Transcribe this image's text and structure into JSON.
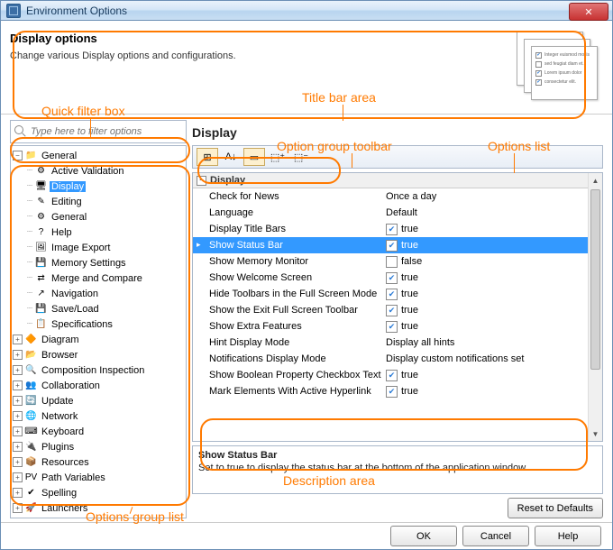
{
  "window": {
    "title": "Environment Options"
  },
  "header": {
    "title": "Display options",
    "subtitle": "Change various Display options and configurations."
  },
  "filter": {
    "placeholder": "Type here to filter options"
  },
  "section_title": "Display",
  "tree": {
    "top": {
      "label": "General",
      "children": [
        "Active Validation",
        "Display",
        "Editing",
        "General",
        "Help",
        "Image Export",
        "Memory Settings",
        "Merge and Compare",
        "Navigation",
        "Save/Load",
        "Specifications"
      ],
      "selected_index": 1
    },
    "rest": [
      "Diagram",
      "Browser",
      "Composition Inspection",
      "Collaboration",
      "Update",
      "Network",
      "Keyboard",
      "Plugins",
      "Resources",
      "Path Variables",
      "Spelling",
      "Launchers"
    ]
  },
  "proplist": {
    "group": "Display",
    "rows": [
      {
        "name": "Check for News",
        "type": "text",
        "value": "Once a day"
      },
      {
        "name": "Language",
        "type": "text",
        "value": "Default"
      },
      {
        "name": "Display Title Bars",
        "type": "check",
        "checked": true,
        "value": "true"
      },
      {
        "name": "Show Status Bar",
        "type": "check",
        "checked": true,
        "value": "true",
        "selected": true
      },
      {
        "name": "Show Memory Monitor",
        "type": "check",
        "checked": false,
        "value": "false"
      },
      {
        "name": "Show Welcome Screen",
        "type": "check",
        "checked": true,
        "value": "true"
      },
      {
        "name": "Hide Toolbars in the Full Screen Mode",
        "type": "check",
        "checked": true,
        "value": "true"
      },
      {
        "name": "Show the Exit Full Screen Toolbar",
        "type": "check",
        "checked": true,
        "value": "true"
      },
      {
        "name": "Show Extra Features",
        "type": "check",
        "checked": true,
        "value": "true"
      },
      {
        "name": "Hint Display Mode",
        "type": "text",
        "value": "Display all hints"
      },
      {
        "name": "Notifications Display Mode",
        "type": "text",
        "value": "Display custom notifications set"
      },
      {
        "name": "Show Boolean Property Checkbox Text",
        "type": "check",
        "checked": true,
        "value": "true"
      },
      {
        "name": "Mark Elements With Active Hyperlink",
        "type": "check",
        "checked": true,
        "value": "true"
      }
    ]
  },
  "description": {
    "title": "Show Status Bar",
    "text": "Set to true to display the status bar at the bottom of the application window."
  },
  "buttons": {
    "reset": "Reset to Defaults",
    "ok": "OK",
    "cancel": "Cancel",
    "help": "Help"
  },
  "annotations": {
    "quick_filter": "Quick filter box",
    "title_bar": "Title bar area",
    "toolbar": "Option group toolbar",
    "options_list": "Options list",
    "group_list": "Options group list",
    "desc": "Description area"
  },
  "tree_icons": [
    "⚙",
    "🖥",
    "✎",
    "⚙",
    "?",
    "🖼",
    "💾",
    "⇄",
    "↗",
    "💾",
    "📋"
  ],
  "rest_icons": [
    "🔶",
    "📂",
    "🔍",
    "👥",
    "🔄",
    "🌐",
    "⌨",
    "🔌",
    "📦",
    "PV",
    "✔",
    "🚀"
  ]
}
